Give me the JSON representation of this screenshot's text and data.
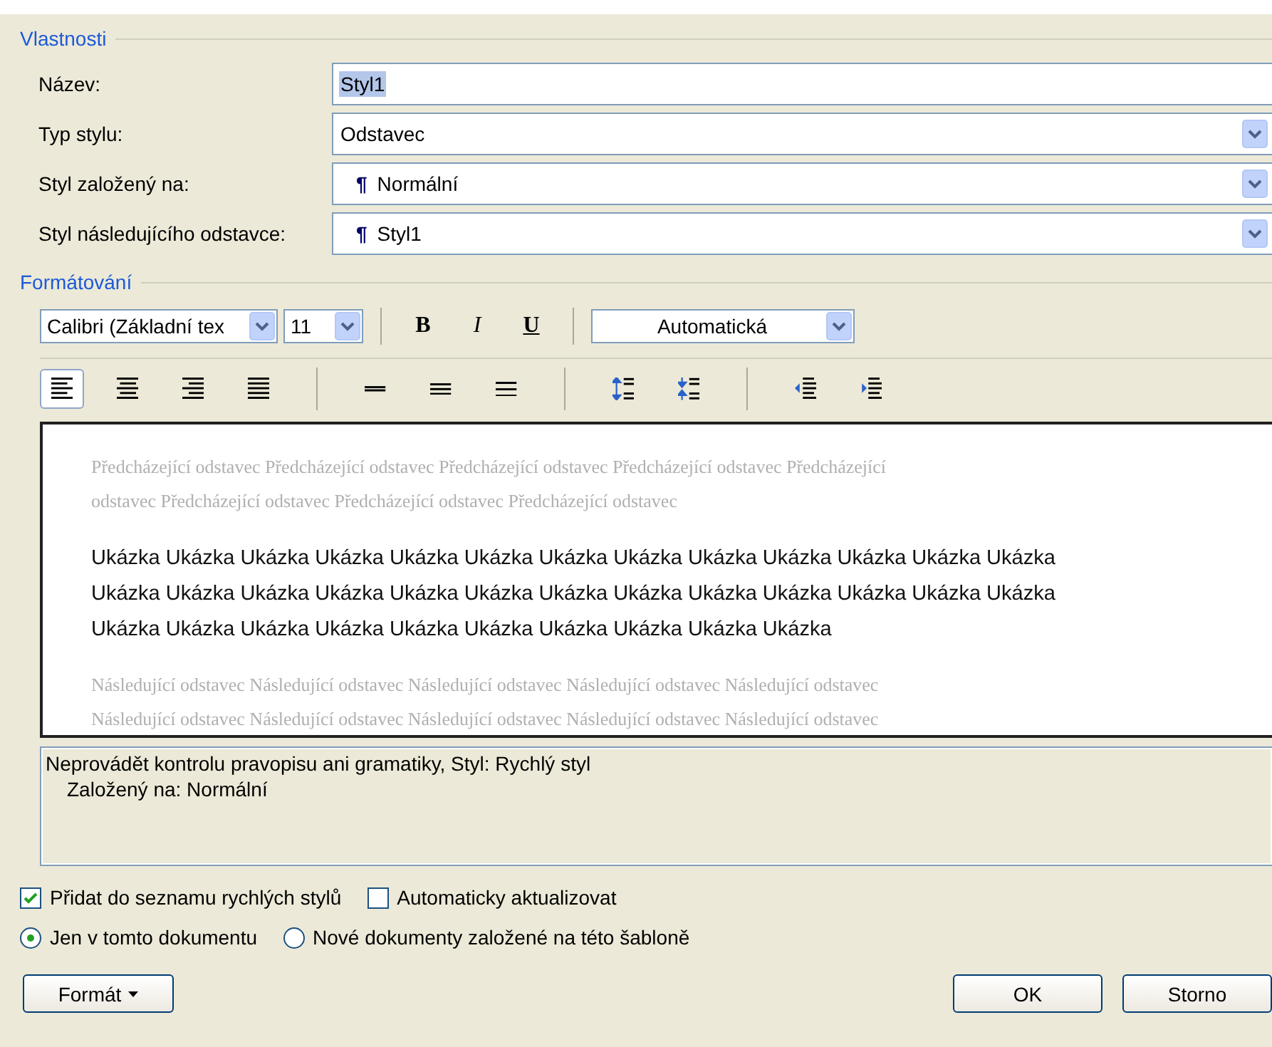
{
  "properties": {
    "legend": "Vlastnosti",
    "rows": [
      {
        "kind": "text",
        "label": "Název:",
        "value": "Styl1",
        "value_selected": true
      },
      {
        "kind": "select",
        "label": "Typ stylu:",
        "value": "Odstavec",
        "value_selected": false
      },
      {
        "kind": "select",
        "label": "Styl založený na:",
        "prefix": "¶",
        "value": "Normální",
        "value_selected": false
      },
      {
        "kind": "select",
        "label": "Styl následujícího odstavce:",
        "prefix": "¶",
        "value": "Styl1",
        "value_selected": false
      }
    ]
  },
  "formatting": {
    "legend": "Formátování",
    "font": "Calibri (Základní tex",
    "size": "11",
    "bold": "B",
    "italic": "I",
    "underline": "U",
    "font_color": "Automatická",
    "paragraph_groups": [
      [
        {
          "kind": "align-left",
          "selected": true
        },
        {
          "kind": "align-center",
          "selected": false
        },
        {
          "kind": "align-right",
          "selected": false
        },
        {
          "kind": "justify",
          "selected": false
        }
      ],
      [
        {
          "kind": "spacing-single",
          "selected": false
        },
        {
          "kind": "spacing-onehalf",
          "selected": false
        },
        {
          "kind": "spacing-double",
          "selected": false
        }
      ],
      [
        {
          "kind": "space-increase",
          "selected": false
        },
        {
          "kind": "space-decrease",
          "selected": false
        }
      ],
      [
        {
          "kind": "indent-decrease",
          "selected": false
        },
        {
          "kind": "indent-increase",
          "selected": false
        }
      ]
    ]
  },
  "preview": {
    "previous_lines": [
      "Předcházející odstavec Předcházející odstavec Předcházející odstavec Předcházející odstavec Předcházející",
      "odstavec Předcházející odstavec Předcházející odstavec Předcházející odstavec"
    ],
    "sample_lines": [
      "Ukázka Ukázka Ukázka Ukázka Ukázka Ukázka Ukázka Ukázka Ukázka Ukázka Ukázka Ukázka Ukázka",
      "Ukázka Ukázka Ukázka Ukázka Ukázka Ukázka Ukázka Ukázka Ukázka Ukázka Ukázka Ukázka Ukázka",
      "Ukázka Ukázka Ukázka Ukázka Ukázka Ukázka Ukázka Ukázka Ukázka Ukázka"
    ],
    "next_lines": [
      "Následující odstavec Následující odstavec Následující odstavec Následující odstavec Následující odstavec",
      "Následující odstavec Následující odstavec Následující odstavec Následující odstavec Následující odstavec"
    ]
  },
  "description": [
    "Neprovádět kontrolu pravopisu ani gramatiky, Styl: Rychlý styl",
    "Založený na: Normální"
  ],
  "checkboxes": [
    {
      "label": "Přidat do seznamu rychlých stylů",
      "checked": true
    },
    {
      "label": "Automaticky aktualizovat",
      "checked": false
    }
  ],
  "radios": [
    {
      "label": "Jen v tomto dokumentu",
      "selected": true
    },
    {
      "label": "Nové dokumenty založené na této šabloně",
      "selected": false
    }
  ],
  "buttons": {
    "format": "Formát",
    "ok": "OK",
    "cancel": "Storno"
  }
}
